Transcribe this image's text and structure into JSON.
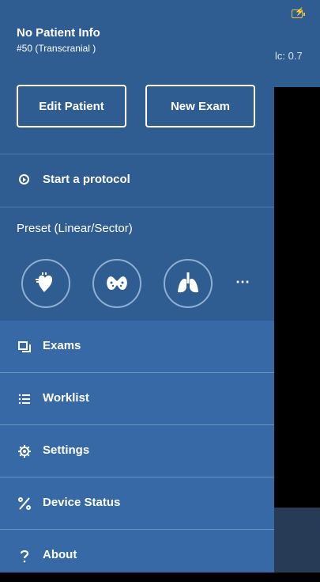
{
  "background": {
    "status_text": "lc: 0.7"
  },
  "patient": {
    "name": "No Patient Info",
    "subtitle": "#50 (Transcranial )"
  },
  "buttons": {
    "edit": "Edit Patient",
    "new": "New Exam"
  },
  "protocol": {
    "label": "Start a protocol"
  },
  "preset": {
    "title": "Preset (Linear/Sector)",
    "icons": [
      "heart-icon",
      "thyroid-icon",
      "lungs-icon",
      "more-icon"
    ],
    "more": "⋯"
  },
  "menu": [
    {
      "icon": "exams-icon",
      "label": "Exams"
    },
    {
      "icon": "worklist-icon",
      "label": "Worklist"
    },
    {
      "icon": "gear-icon",
      "label": "Settings"
    },
    {
      "icon": "percent-icon",
      "label": "Device Status"
    },
    {
      "icon": "help-icon",
      "label": "About"
    }
  ],
  "colors": {
    "drawer": "#2f5d92",
    "menu": "#3769a6",
    "text": "#ffffff"
  }
}
